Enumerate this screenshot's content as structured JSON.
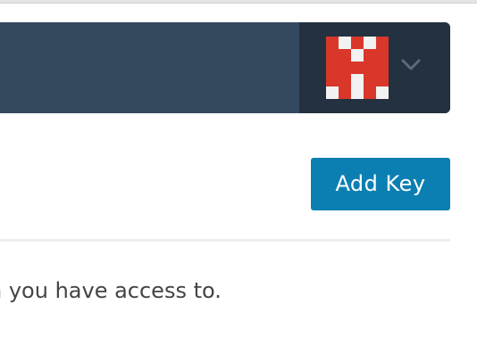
{
  "header": {
    "avatar_alt": "user avatar",
    "icons": {
      "avatar": "identicon-avatar",
      "dropdown": "chevron-down-icon"
    },
    "colors": {
      "navbar": "#34495e",
      "user_area": "#233140",
      "avatar_red": "#d9372a",
      "avatar_light": "#f2f2f2"
    }
  },
  "toolbar": {
    "add_key_label": "Add Key",
    "button_color": "#0c7fb2"
  },
  "main": {
    "description": "n you have access to."
  }
}
